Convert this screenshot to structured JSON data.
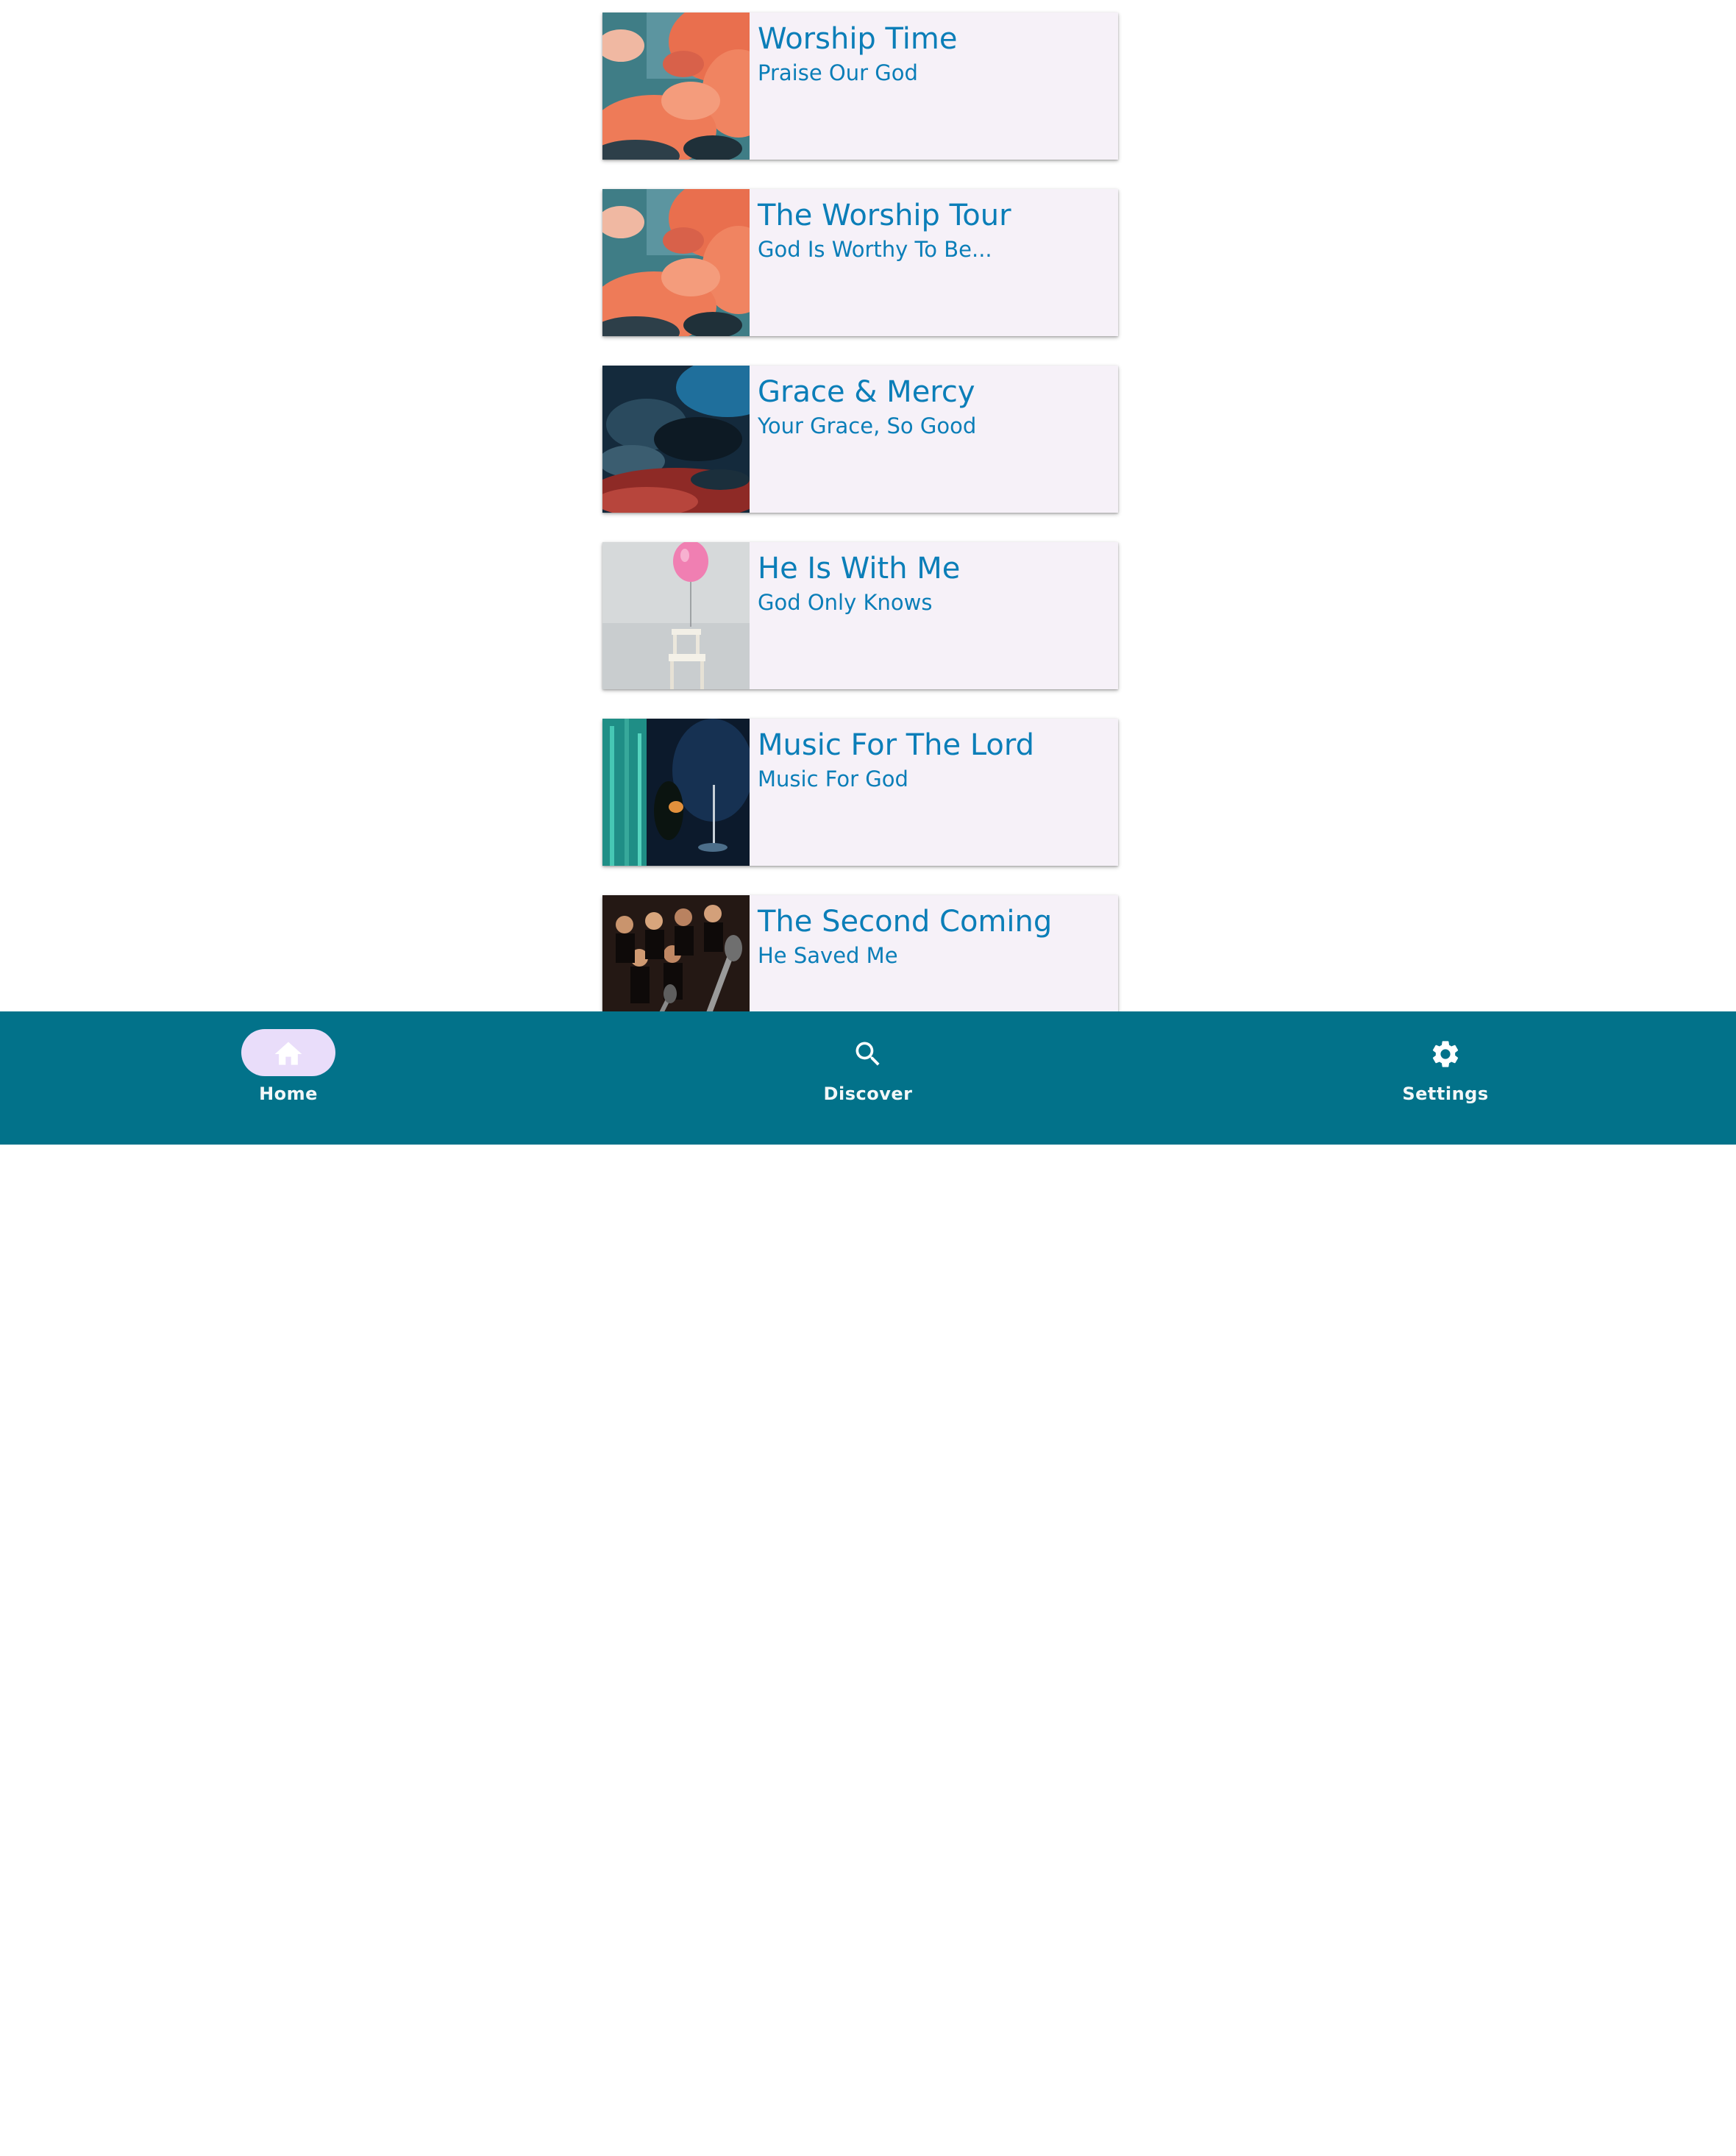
{
  "cards": [
    {
      "title": "Worship Time",
      "subtitle": "Praise Our God",
      "image": "clouds-artwork"
    },
    {
      "title": "The Worship Tour",
      "subtitle": "God Is Worthy To Be...",
      "image": "clouds-artwork"
    },
    {
      "title": "Grace & Mercy",
      "subtitle": "Your Grace, So Good",
      "image": "smoke-artwork"
    },
    {
      "title": "He Is With Me",
      "subtitle": "God Only Knows",
      "image": "balloon-chair-artwork"
    },
    {
      "title": "Music For The Lord",
      "subtitle": "Music For God",
      "image": "guitarist-artwork"
    },
    {
      "title": "The Second Coming",
      "subtitle": "He Saved Me",
      "image": "choir-artwork"
    }
  ],
  "nav": {
    "items": [
      {
        "label": "Home",
        "icon": "home-icon",
        "active": true
      },
      {
        "label": "Discover",
        "icon": "search-icon",
        "active": false
      },
      {
        "label": "Settings",
        "icon": "gear-icon",
        "active": false
      }
    ]
  },
  "colors": {
    "accent_text": "#0b7eb8",
    "card_background": "#f6f1f8",
    "nav_background": "#02728a",
    "nav_active_pill": "#e9ddfa"
  }
}
